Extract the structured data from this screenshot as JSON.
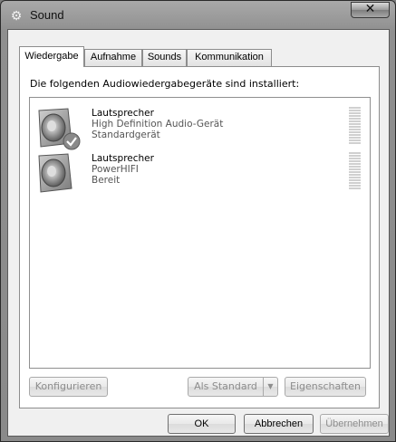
{
  "window": {
    "title": "Sound"
  },
  "tabs": [
    {
      "label": "Wiedergabe"
    },
    {
      "label": "Aufnahme"
    },
    {
      "label": "Sounds"
    },
    {
      "label": "Kommunikation"
    }
  ],
  "panel": {
    "heading": "Die folgenden Audiowiedergabegeräte sind installiert:"
  },
  "devices": [
    {
      "name": "Lautsprecher",
      "description": "High Definition Audio-Gerät",
      "status": "Standardgerät",
      "icon": "speaker-icon",
      "badge": "default-check-icon"
    },
    {
      "name": "Lautsprecher",
      "description": "PowerHIFI",
      "status": "Bereit",
      "icon": "speaker-icon"
    }
  ],
  "buttons": {
    "configure": "Konfigurieren",
    "set_default": "Als Standard",
    "properties": "Eigenschaften",
    "ok": "OK",
    "cancel": "Abbrechen",
    "apply": "Übernehmen"
  }
}
